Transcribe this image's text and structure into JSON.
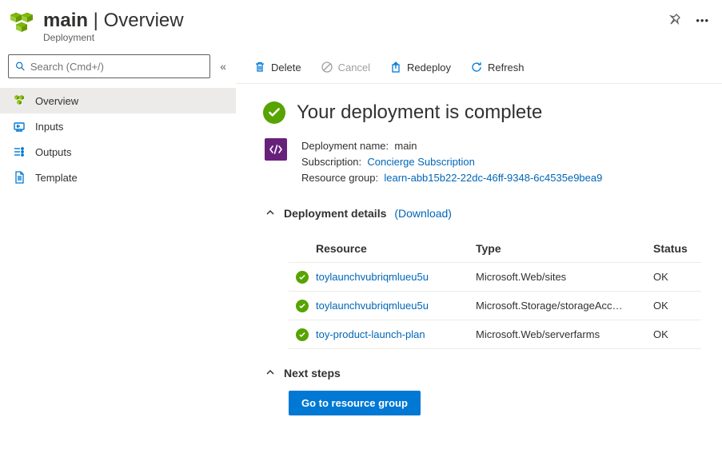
{
  "header": {
    "title_bold": "main",
    "title_sep": " | ",
    "title_rest": "Overview",
    "subtitle": "Deployment"
  },
  "search": {
    "placeholder": "Search (Cmd+/)"
  },
  "nav": {
    "items": [
      {
        "label": "Overview"
      },
      {
        "label": "Inputs"
      },
      {
        "label": "Outputs"
      },
      {
        "label": "Template"
      }
    ]
  },
  "toolbar": {
    "delete": "Delete",
    "cancel": "Cancel",
    "redeploy": "Redeploy",
    "refresh": "Refresh"
  },
  "status": {
    "title": "Your deployment is complete"
  },
  "details": {
    "name_label": "Deployment name:",
    "name_value": "main",
    "sub_label": "Subscription:",
    "sub_value": "Concierge Subscription",
    "rg_label": "Resource group:",
    "rg_value": "learn-abb15b22-22dc-46ff-9348-6c4535e9bea9"
  },
  "deployment_details": {
    "title": "Deployment details",
    "download": "(Download)",
    "columns": {
      "resource": "Resource",
      "type": "Type",
      "status": "Status"
    },
    "rows": [
      {
        "resource": "toylaunchvubriqmlueu5u",
        "type": "Microsoft.Web/sites",
        "status": "OK"
      },
      {
        "resource": "toylaunchvubriqmlueu5u",
        "type": "Microsoft.Storage/storageAcc…",
        "status": "OK"
      },
      {
        "resource": "toy-product-launch-plan",
        "type": "Microsoft.Web/serverfarms",
        "status": "OK"
      }
    ]
  },
  "next_steps": {
    "title": "Next steps",
    "button": "Go to resource group"
  },
  "colors": {
    "link": "#0066b8",
    "primary": "#0078d4",
    "success": "#57a300",
    "purple": "#68217a",
    "cube": "#7fba00"
  }
}
